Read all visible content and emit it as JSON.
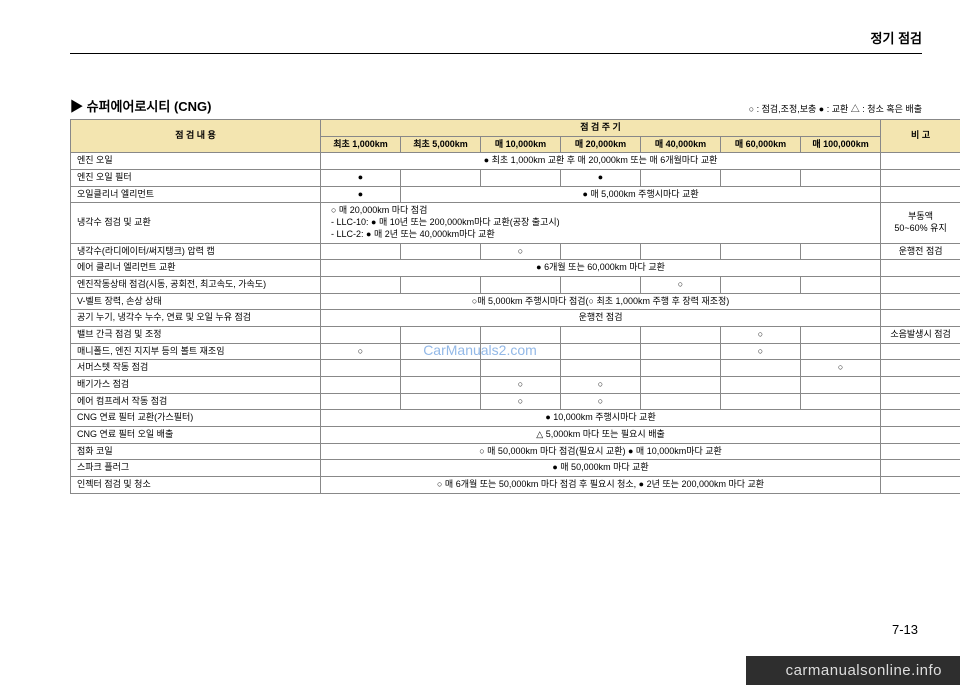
{
  "header": {
    "title": "정기 점검"
  },
  "section": {
    "title": "▶ 슈퍼에어로시티 (CNG)",
    "legend": "○ : 점검,조정,보충   ● : 교환   △ : 청소 혹은 배출"
  },
  "table": {
    "head": {
      "item": "점    검    내    용",
      "period": "점    검    주    기",
      "remark": "비 고",
      "cols": [
        "최초 1,000km",
        "최초 5,000km",
        "매 10,000km",
        "매 20,000km",
        "매 40,000km",
        "매 60,000km",
        "매 100,000km"
      ]
    },
    "rows": [
      {
        "item": "엔진 오일",
        "span": "● 최초 1,000km 교환 후 매 20,000km 또는 매 6개월마다 교환",
        "remark": ""
      },
      {
        "item": "엔진 오일 필터",
        "cells": [
          "●",
          "",
          "",
          "●",
          "",
          "",
          ""
        ],
        "remark": ""
      },
      {
        "item": "오일클리너 엘리먼트",
        "custom": {
          "c1": "●",
          "rest": "● 매 5,000km 주행시마다 교환"
        },
        "remark": ""
      },
      {
        "item": "냉각수 점검 및 교환",
        "span": "○ 매 20,000km 마다 점검\n  - LLC-10: ● 매 10년 또는 200,000km마다 교환(공장 출고시)\n  - LLC-2: ● 매 2년 또는 40,000km마다 교환",
        "align": "left",
        "remark": "부동액\n50~60% 유지"
      },
      {
        "item": "냉각수(라디에이터/써지탱크) 압력 캡",
        "cells": [
          "",
          "",
          "○",
          "",
          "",
          "",
          ""
        ],
        "remark": "운행전 점검"
      },
      {
        "item": "에어 클리너 엘리먼트 교환",
        "span": "● 6개월 또는 60,000km 마다 교환",
        "remark": ""
      },
      {
        "item": "엔진작동상태 점검(시동, 공회전, 최고속도, 가속도)",
        "cells": [
          "",
          "",
          "",
          "",
          "○",
          "",
          ""
        ],
        "remark": ""
      },
      {
        "item": "V-벨트 장력, 손상 상태",
        "span": "○매 5,000km 주행시마다 점검(○ 최초 1,000km 주행 후 장력 재조정)",
        "remark": ""
      },
      {
        "item": "공기 누기, 냉각수 누수, 연료 및 오일 누유 점검",
        "span": "운행전 점검",
        "remark": ""
      },
      {
        "item": "밸브 간극 점검 및 조정",
        "cells": [
          "",
          "",
          "",
          "",
          "",
          "○",
          ""
        ],
        "remark": "소음발생시 점검"
      },
      {
        "item": "매니폴드, 엔진 지지부 등의 볼트 재조임",
        "cells": [
          "○",
          "",
          "",
          "",
          "",
          "○",
          ""
        ],
        "remark": ""
      },
      {
        "item": "서머스텟 작동 점검",
        "cells": [
          "",
          "",
          "",
          "",
          "",
          "",
          "○"
        ],
        "remark": ""
      },
      {
        "item": "배기가스 점검",
        "cells": [
          "",
          "",
          "○",
          "○",
          "",
          "",
          ""
        ],
        "remark": ""
      },
      {
        "item": "에어 컴프레서 작동 점검",
        "cells": [
          "",
          "",
          "○",
          "○",
          "",
          "",
          ""
        ],
        "remark": ""
      },
      {
        "item": "CNG 연료 필터 교환(가스필터)",
        "span": "● 10,000km 주행시마다 교환",
        "remark": ""
      },
      {
        "item": "CNG 연료 필터 오일 배출",
        "span": "△ 5,000km 마다 또는 필요시 배출",
        "remark": ""
      },
      {
        "item": "점화 코일",
        "span": "○ 매 50,000km 마다 점검(필요시 교환) ● 매 10,000km마다 교환",
        "remark": ""
      },
      {
        "item": "스파크 플러그",
        "span": "● 매 50,000km 마다 교환",
        "remark": ""
      },
      {
        "item": "인젝터 점검 및 청소",
        "span": "○ 매 6개월 또는 50,000km 마다 점검 후 필요시 청소, ● 2년 또는 200,000km 마다 교환",
        "remark": ""
      }
    ]
  },
  "watermark": "CarManuals2.com",
  "pageNumber": "7-13",
  "footerBrand": "carmanualsonline.info"
}
